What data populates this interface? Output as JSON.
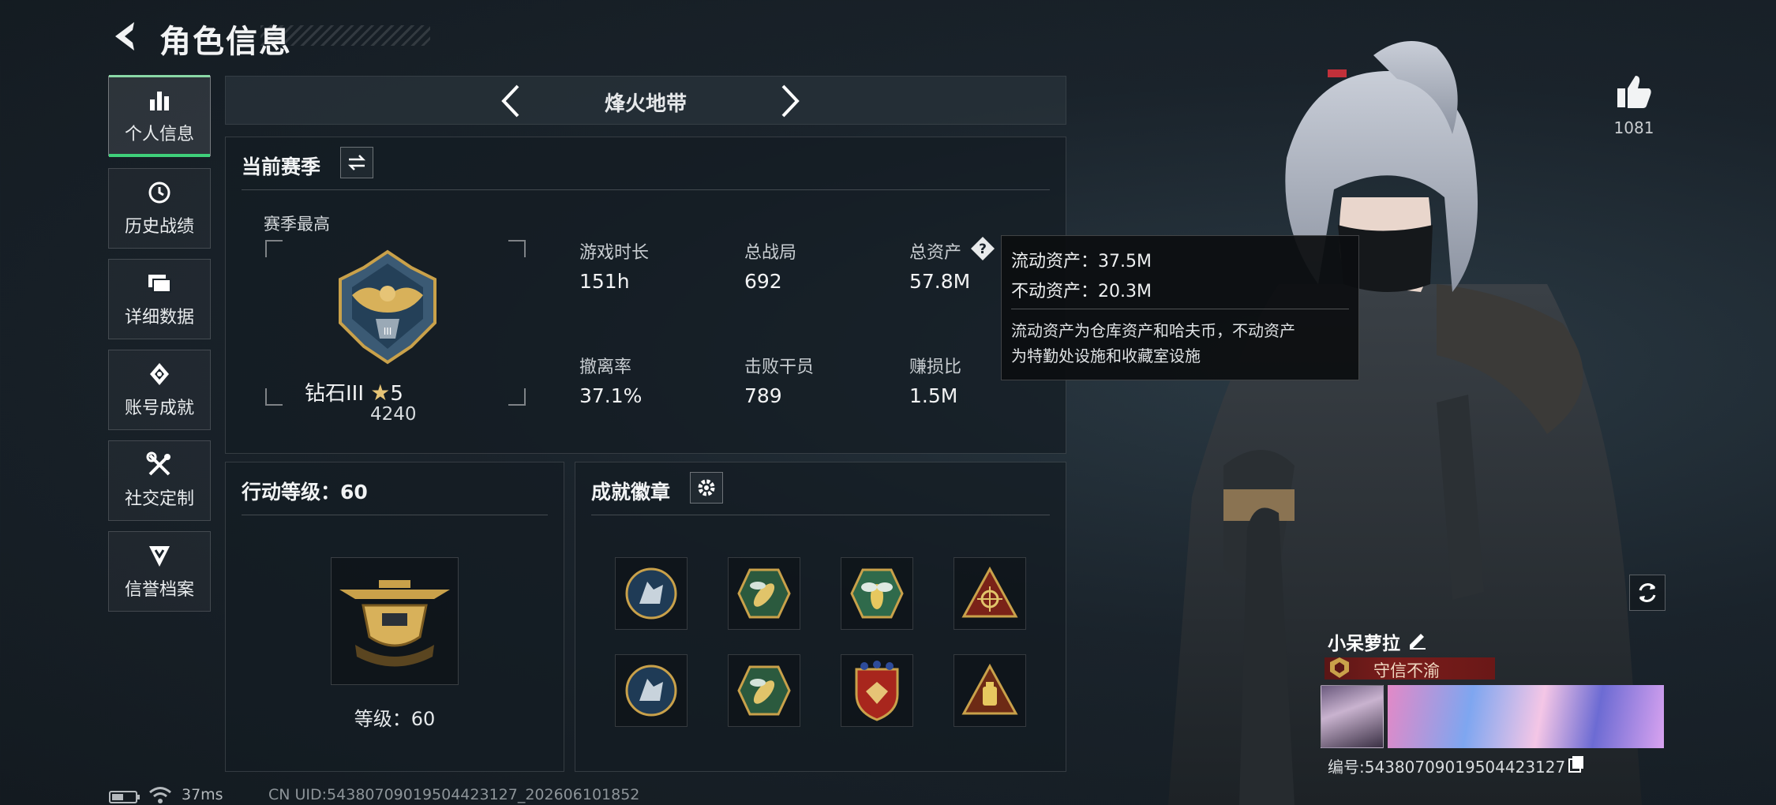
{
  "header": {
    "title": "角色信息"
  },
  "nav": {
    "items": [
      {
        "label": "个人信息",
        "icon": "bar-chart-icon",
        "active": true
      },
      {
        "label": "历史战绩",
        "icon": "history-icon",
        "active": false
      },
      {
        "label": "详细数据",
        "icon": "folders-icon",
        "active": false
      },
      {
        "label": "账号成就",
        "icon": "achievement-icon",
        "active": false
      },
      {
        "label": "社交定制",
        "icon": "tools-icon",
        "active": false
      },
      {
        "label": "信誉档案",
        "icon": "shield-icon",
        "active": false
      }
    ]
  },
  "mode": {
    "title": "烽火地带"
  },
  "season": {
    "title": "当前赛季",
    "best_label": "赛季最高",
    "rank_name": "钻石III",
    "rank_stars": "5",
    "rank_points": "4240",
    "stats": [
      {
        "label": "游戏时长",
        "value": "151h"
      },
      {
        "label": "总战局",
        "value": "692"
      },
      {
        "label": "总资产",
        "value": "57.8M"
      },
      {
        "label": "撤离率",
        "value": "37.1%"
      },
      {
        "label": "击败干员",
        "value": "789"
      },
      {
        "label": "赚损比",
        "value": "1.5M"
      }
    ]
  },
  "tooltip": {
    "liquid": "流动资产：37.5M",
    "fixed": "不动资产：20.3M",
    "desc_line1": "流动资产为仓库资产和哈夫币，不动资产",
    "desc_line2": "为特勤处设施和收藏室设施"
  },
  "level": {
    "title": "行动等级：60",
    "label": "等级：60"
  },
  "badges": {
    "title": "成就徽章",
    "items": [
      "wolf-badge-icon",
      "wasp-badge-icon",
      "bee-badge-icon",
      "crosshair-badge-icon",
      "wolf-badge-icon",
      "wasp-badge-icon",
      "eagle-shield-badge-icon",
      "lantern-badge-icon"
    ]
  },
  "profile": {
    "likes": "1081",
    "name": "小呆萝拉",
    "title": "守信不渝",
    "id": "编号:5438070901950442312​7"
  },
  "footer": {
    "ping": "37ms",
    "uid": "CN UID:5438070901950442312​7_202606101852"
  },
  "colors": {
    "accent": "#3fd07a",
    "title_red": "#7a1d1b",
    "gold": "#c9a14a"
  }
}
